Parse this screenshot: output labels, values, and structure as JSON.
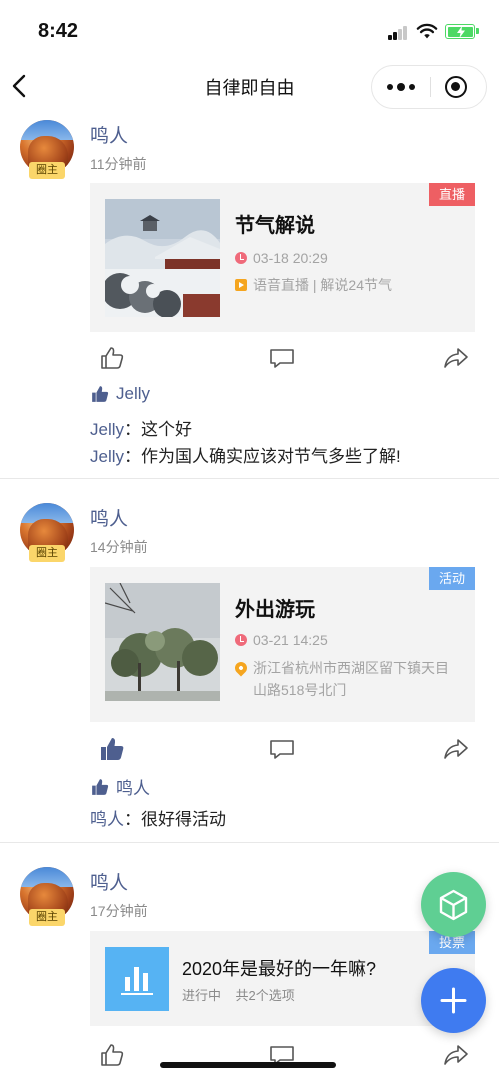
{
  "status_bar": {
    "time": "8:42"
  },
  "nav": {
    "title": "自律即自由"
  },
  "posts": [
    {
      "author": "鸣人",
      "owner_badge": "圈主",
      "time": "11分钟前",
      "card": {
        "tag": "直播",
        "title": "节气解说",
        "datetime": "03-18 20:29",
        "detail": "语音直播 | 解说24节气"
      },
      "likes": "Jelly",
      "comments": [
        {
          "author": "Jelly",
          "sep": "：",
          "text": "这个好"
        },
        {
          "author": "Jelly",
          "sep": "：",
          "text": "作为国人确实应该对节气多些了解!"
        }
      ]
    },
    {
      "author": "鸣人",
      "owner_badge": "圈主",
      "time": "14分钟前",
      "card": {
        "tag": "活动",
        "title": "外出游玩",
        "datetime": "03-21 14:25",
        "address_line1": "浙江省杭州市西湖区留下镇天目",
        "address_line2": "山路518号北门"
      },
      "likes": "鸣人",
      "comments": [
        {
          "author": "鸣人",
          "sep": "：",
          "text": "很好得活动"
        }
      ]
    },
    {
      "author": "鸣人",
      "owner_badge": "圈主",
      "time": "17分钟前",
      "card": {
        "tag": "投票",
        "title": "2020年是最好的一年嘛?",
        "status": "进行中",
        "options": "共2个选项"
      }
    }
  ],
  "colors": {
    "author_blue": "#4e5f8f",
    "live_red": "#ee5f63",
    "event_blue": "#6aa8ef",
    "fab_green": "#5fcf93",
    "fab_blue": "#3f7bf0"
  }
}
